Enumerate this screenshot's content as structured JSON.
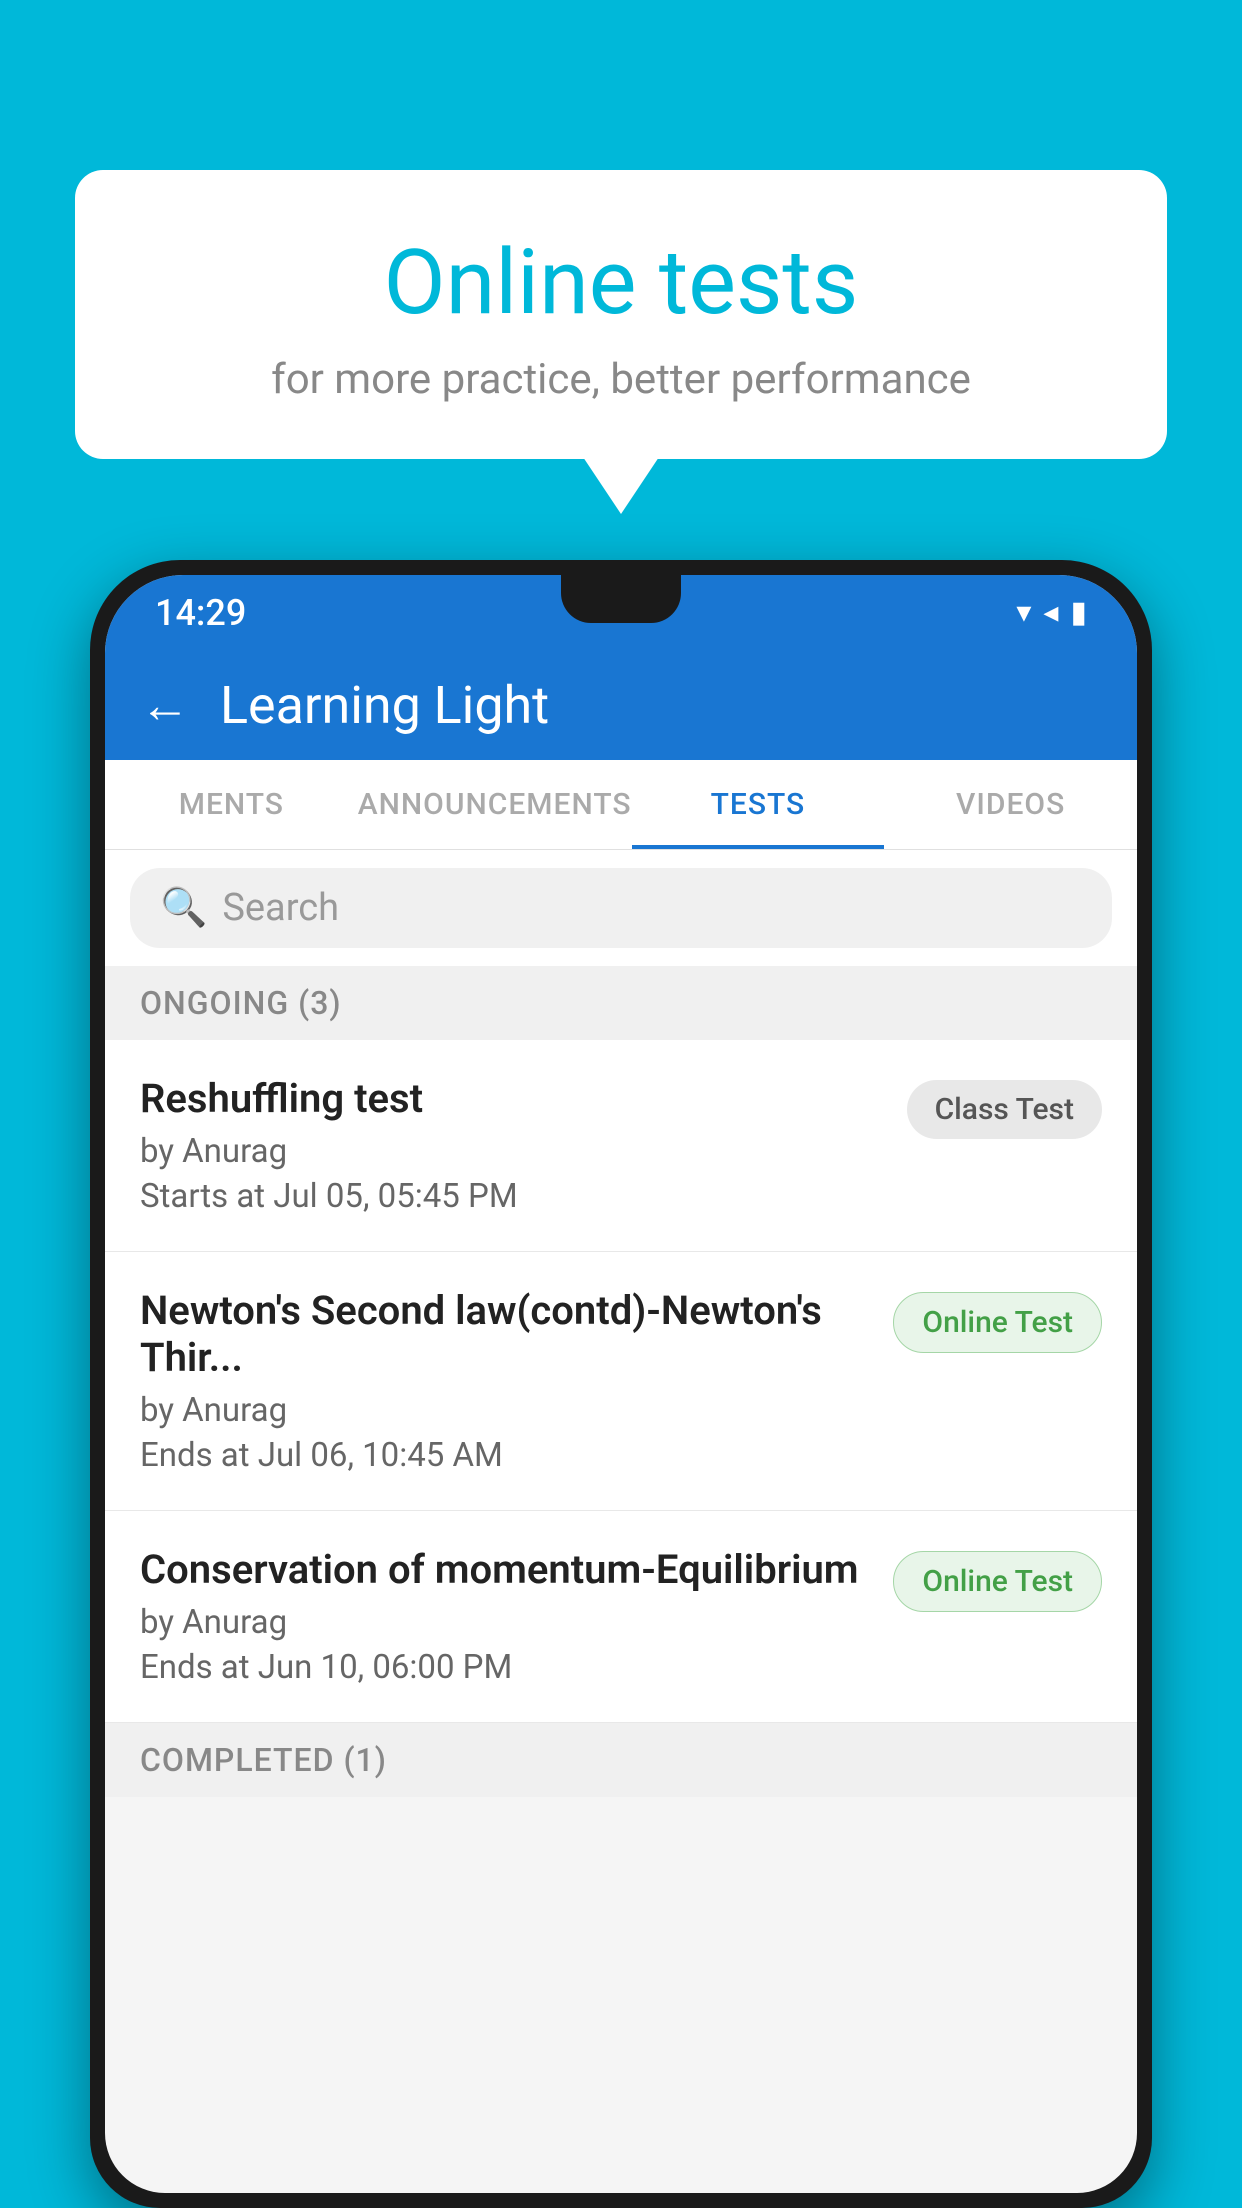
{
  "background": {
    "color": "#00b8d9"
  },
  "speech_bubble": {
    "title": "Online tests",
    "subtitle": "for more practice, better performance"
  },
  "phone": {
    "status_bar": {
      "time": "14:29",
      "icons": [
        "wifi",
        "signal",
        "battery"
      ]
    },
    "app_bar": {
      "back_label": "←",
      "title": "Learning Light"
    },
    "tabs": [
      {
        "label": "MENTS",
        "active": false
      },
      {
        "label": "ANNOUNCEMENTS",
        "active": false
      },
      {
        "label": "TESTS",
        "active": true
      },
      {
        "label": "VIDEOS",
        "active": false
      }
    ],
    "search": {
      "placeholder": "Search"
    },
    "sections": [
      {
        "header": "ONGOING (3)",
        "items": [
          {
            "name": "Reshuffling test",
            "author": "by Anurag",
            "date": "Starts at  Jul 05, 05:45 PM",
            "badge": "Class Test",
            "badge_type": "class"
          },
          {
            "name": "Newton's Second law(contd)-Newton's Thir...",
            "author": "by Anurag",
            "date": "Ends at  Jul 06, 10:45 AM",
            "badge": "Online Test",
            "badge_type": "online"
          },
          {
            "name": "Conservation of momentum-Equilibrium",
            "author": "by Anurag",
            "date": "Ends at  Jun 10, 06:00 PM",
            "badge": "Online Test",
            "badge_type": "online"
          }
        ]
      },
      {
        "header": "COMPLETED (1)",
        "items": []
      }
    ]
  }
}
